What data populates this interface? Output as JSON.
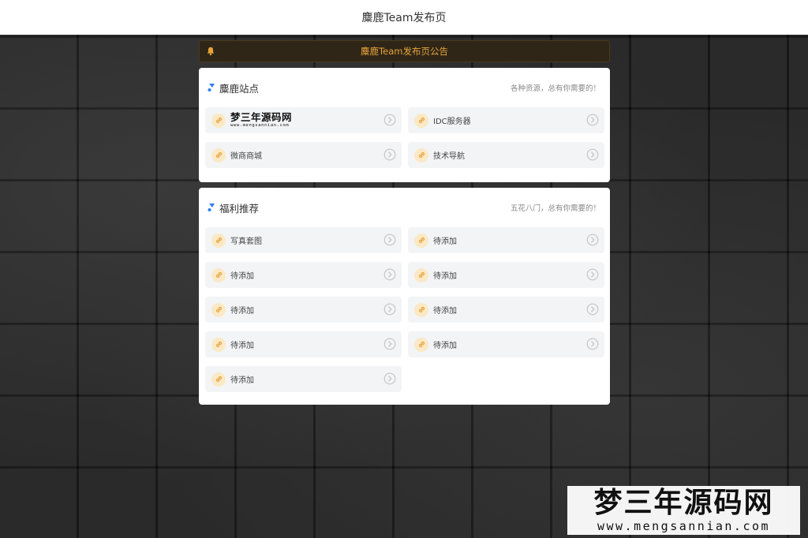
{
  "header": {
    "title": "麋鹿Team发布页"
  },
  "notice": {
    "text": "麋鹿Team发布页公告",
    "icon": "bell-icon"
  },
  "sections": [
    {
      "title": "麋鹿站点",
      "subtitle": "各种资源，总有你需要的！",
      "items": [
        {
          "label": "梦三年源码网",
          "sublabel": "www.mengsannian.com",
          "logo": true
        },
        {
          "label": "IDC服务器"
        },
        {
          "label": "微商商城"
        },
        {
          "label": "技术导航"
        }
      ]
    },
    {
      "title": "福利推荐",
      "subtitle": "五花八门，总有你需要的！",
      "items": [
        {
          "label": "写真套图"
        },
        {
          "label": "待添加"
        },
        {
          "label": "待添加"
        },
        {
          "label": "待添加"
        },
        {
          "label": "待添加"
        },
        {
          "label": "待添加"
        },
        {
          "label": "待添加"
        },
        {
          "label": "待添加"
        },
        {
          "label": "待添加"
        }
      ]
    }
  ],
  "watermark": {
    "title": "梦三年源码网",
    "url": "www.mengsannian.com"
  },
  "colors": {
    "accent": "#e6a43a",
    "title_icon": "#2f7df6",
    "link_icon_bg": "#fbe9c6"
  }
}
